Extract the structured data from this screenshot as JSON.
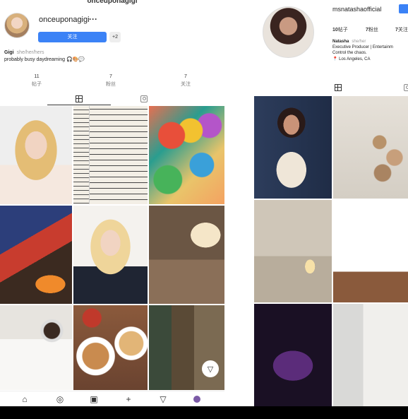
{
  "left_profile": {
    "header_title": "onceuponagigi",
    "username": "onceuponagigi",
    "more": "···",
    "follow_label": "关注",
    "add_person_label": "+2",
    "name": "Gigi",
    "pronouns": "she/her/hers",
    "bio": "probably busy daydreaming 🎧🎨💬",
    "stats": [
      {
        "value": "11",
        "label": "帖子"
      },
      {
        "value": "7",
        "label": "粉丝"
      },
      {
        "value": "7",
        "label": "关注"
      }
    ],
    "tabs": [
      "grid-icon",
      "tagged-icon"
    ],
    "posts": [
      "blonde-portrait",
      "open-book",
      "colorful-abstract",
      "board-game",
      "blonde-portrait-2",
      "lamp-table",
      "journal-coffee",
      "pancakes-food",
      "cozy-room"
    ],
    "nav": [
      "home-icon",
      "explore-icon",
      "reels-icon",
      "create-icon",
      "send-icon",
      "profile-icon"
    ]
  },
  "right_profile": {
    "username": "msnatashaofficial",
    "stats": [
      {
        "value": "10",
        "label": "帖子"
      },
      {
        "value": "7",
        "label": "粉丝"
      },
      {
        "value": "7",
        "label": "关注"
      }
    ],
    "name": "Natasha",
    "pronouns": "she/her",
    "bio_line1": "Executive Producer | Entertainm",
    "bio_line2": "Control the chaos.",
    "location": "📍 Los Angeles, CA",
    "posts": [
      "woman-portrait",
      "makeup-flatlay",
      "laptop-candle",
      "calendar-desk",
      "car-interior",
      "white-door"
    ]
  }
}
